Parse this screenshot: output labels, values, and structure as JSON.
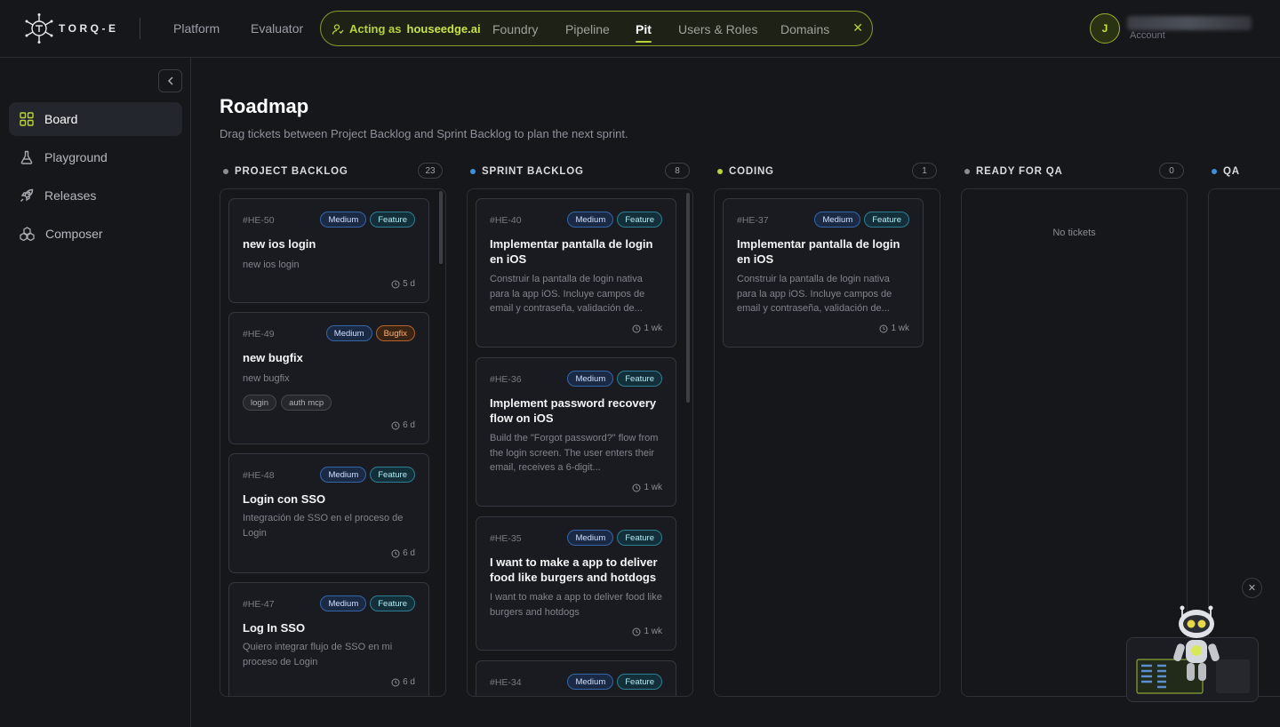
{
  "brand": {
    "logo_text": "TORQ-E"
  },
  "nav": {
    "platform": "Platform",
    "evaluator": "Evaluator"
  },
  "acting": {
    "prefix": "Acting as",
    "org": "houseedge.ai",
    "tabs": [
      "Foundry",
      "Pipeline",
      "Pit",
      "Users & Roles",
      "Domains"
    ],
    "active_tab": "Pit"
  },
  "user": {
    "initial": "J",
    "account_label": "Account"
  },
  "sidebar": {
    "items": [
      {
        "label": "Board",
        "icon": "grid-icon",
        "active": true
      },
      {
        "label": "Playground",
        "icon": "flask-icon"
      },
      {
        "label": "Releases",
        "icon": "rocket-icon"
      },
      {
        "label": "Composer",
        "icon": "cubes-icon"
      }
    ]
  },
  "page": {
    "title": "Roadmap",
    "subtitle": "Drag tickets between Project Backlog and Sprint Backlog to plan the next sprint."
  },
  "colors": {
    "accent": "#b9d33a",
    "project_backlog_dot": "#8a8e95",
    "sprint_backlog_dot": "#3d8fe0",
    "coding_dot": "#b9d33a",
    "ready_for_qa_dot": "#8a8e95",
    "qa_dot": "#3d8fe0"
  },
  "columns": [
    {
      "name": "PROJECT BACKLOG",
      "count": "23",
      "cards": [
        {
          "id": "#HE-50",
          "priority": "Medium",
          "type": "Feature",
          "title": "new ios login",
          "desc": "new ios login",
          "time": "5 d"
        },
        {
          "id": "#HE-49",
          "priority": "Medium",
          "type": "Bugfix",
          "title": "new bugfix",
          "desc": "new bugfix",
          "labels": [
            "login",
            "auth mcp"
          ],
          "time": "6 d"
        },
        {
          "id": "#HE-48",
          "priority": "Medium",
          "type": "Feature",
          "title": "Login con SSO",
          "desc": "Integración de SSO en el proceso de Login",
          "time": "6 d"
        },
        {
          "id": "#HE-47",
          "priority": "Medium",
          "type": "Feature",
          "title": "Log In SSO",
          "desc": "Quiero integrar flujo de SSO en mi proceso de Login",
          "time": "6 d"
        }
      ]
    },
    {
      "name": "SPRINT BACKLOG",
      "count": "8",
      "cards": [
        {
          "id": "#HE-40",
          "priority": "Medium",
          "type": "Feature",
          "title": "Implementar pantalla de login en iOS",
          "desc": "Construir la pantalla de login nativa para la app iOS. Incluye campos de email y contraseña, validación de...",
          "time": "1 wk"
        },
        {
          "id": "#HE-36",
          "priority": "Medium",
          "type": "Feature",
          "title": "Implement password recovery flow on iOS",
          "desc": "Build the \"Forgot password?\" flow from the login screen. The user enters their email, receives a 6-digit...",
          "time": "1 wk"
        },
        {
          "id": "#HE-35",
          "priority": "Medium",
          "type": "Feature",
          "title": "I want to make a app to deliver food like burgers and hotdogs",
          "desc": "I want to make a app to deliver food like burgers and hotdogs",
          "time": "1 wk"
        },
        {
          "id": "#HE-34",
          "priority": "Medium",
          "type": "Feature"
        }
      ]
    },
    {
      "name": "CODING",
      "count": "1",
      "cards": [
        {
          "id": "#HE-37",
          "priority": "Medium",
          "type": "Feature",
          "title": "Implementar pantalla de login en iOS",
          "desc": "Construir la pantalla de login nativa para la app iOS. Incluye campos de email y contraseña, validación de...",
          "time": "1 wk"
        }
      ]
    },
    {
      "name": "READY FOR QA",
      "count": "0",
      "empty_text": "No tickets"
    },
    {
      "name": "QA"
    }
  ]
}
